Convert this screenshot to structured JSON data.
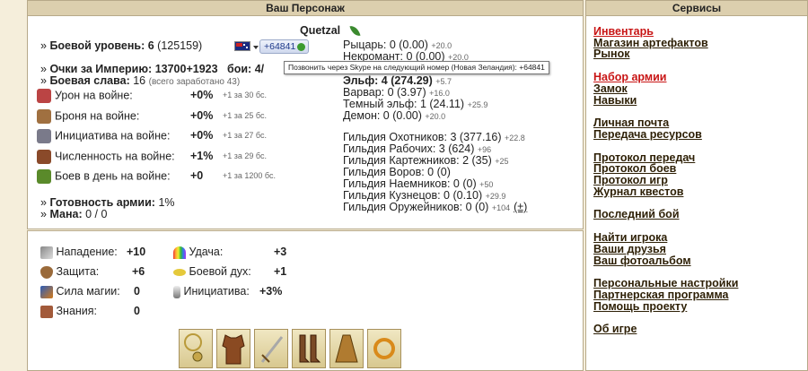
{
  "character": {
    "header": "Ваш Персонаж",
    "name": "Quetzal",
    "combat_level_label": "Боевой уровень:",
    "combat_level": "6",
    "combat_exp": "(125159)",
    "phone_number": "+64841",
    "phone_tooltip": "Позвонить через Skype на следующий номер (Новая Зеландия): +64841",
    "empire_points_label": "Очки за Империю:",
    "empire_points": "13700+1923",
    "battles_label": "бои:",
    "battles": "4/",
    "glory_label": "Боевая слава:",
    "glory": "16",
    "glory_total": "(всего заработано 43)",
    "war_rows": [
      {
        "label": "Урон на войне:",
        "value": "+0%",
        "note": "+1 за 30 бс.",
        "icon": "sword-damage-icon"
      },
      {
        "label": "Броня на войне:",
        "value": "+0%",
        "note": "+1 за 25 бс.",
        "icon": "armor-icon"
      },
      {
        "label": "Инициатива на войне:",
        "value": "+0%",
        "note": "+1 за 27 бс.",
        "icon": "initiative-icon"
      },
      {
        "label": "Численность на войне:",
        "value": "+1%",
        "note": "+1 за 29 бс.",
        "icon": "army-size-icon"
      },
      {
        "label": "Боев в день на войне:",
        "value": "+0",
        "note": "+1 за 1200 бс.",
        "icon": "battles-per-day-icon"
      }
    ],
    "readiness_label": "Готовность армии:",
    "readiness": "1%",
    "mana_label": "Мана:",
    "mana": "0 / 0",
    "factions": [
      {
        "text": "Рыцарь: 0 (0.00)",
        "note": "+20.0"
      },
      {
        "text": "Некромант: 0 (0.00)",
        "note": "+20.0"
      },
      {
        "text": "Эльф: 4 (274.29)",
        "note": "+5.7"
      },
      {
        "text": "Варвар: 0 (3.97)",
        "note": "+16.0"
      },
      {
        "text": "Темный эльф: 1 (24.11)",
        "note": "+25.9"
      },
      {
        "text": "Демон: 0 (0.00)",
        "note": "+20.0"
      }
    ],
    "guilds": [
      {
        "text": "Гильдия Охотников: 3 (377.16)",
        "note": "+22.8"
      },
      {
        "text": "Гильдия Рабочих: 3 (624)",
        "note": "+96"
      },
      {
        "text": "Гильдия Картежников: 2 (35)",
        "note": "+25"
      },
      {
        "text": "Гильдия Воров: 0 (0)",
        "note": ""
      },
      {
        "text": "Гильдия Наемников: 0 (0)",
        "note": "+50"
      },
      {
        "text": "Гильдия Кузнецов: 0 (0.10)",
        "note": "+29.9"
      },
      {
        "text": "Гильдия Оружейников: 0 (0)",
        "note": "+104"
      }
    ],
    "guild_plus": "(±)"
  },
  "stats": {
    "attack_label": "Нападение:",
    "attack": "+10",
    "defense_label": "Защита:",
    "defense": "+6",
    "magic_label": "Сила магии:",
    "magic": "0",
    "knowledge_label": "Знания:",
    "knowledge": "0",
    "luck_label": "Удача:",
    "luck": "+3",
    "morale_label": "Боевой дух:",
    "morale": "+1",
    "initiative_label": "Инициатива:",
    "initiative": "+3%"
  },
  "services": {
    "header": "Сервисы",
    "groups": [
      [
        {
          "label": "Инвентарь",
          "red": true
        },
        {
          "label": "Магазин артефактов"
        },
        {
          "label": "Рынок"
        }
      ],
      [
        {
          "label": "Набор армии",
          "red": true
        },
        {
          "label": "Замок"
        },
        {
          "label": "Навыки"
        }
      ],
      [
        {
          "label": "Личная почта"
        },
        {
          "label": "Передача ресурсов"
        }
      ],
      [
        {
          "label": "Протокол передач"
        },
        {
          "label": "Протокол боев"
        },
        {
          "label": "Протокол игр"
        },
        {
          "label": "Журнал квестов"
        }
      ],
      [
        {
          "label": "Последний бой"
        }
      ],
      [
        {
          "label": "Найти игрока"
        },
        {
          "label": "Ваши друзья"
        },
        {
          "label": "Ваш фотоальбом"
        }
      ],
      [
        {
          "label": "Персональные настройки"
        },
        {
          "label": "Партнерская программа"
        },
        {
          "label": "Помощь проекту"
        }
      ],
      [
        {
          "label": "Об игре"
        }
      ]
    ]
  },
  "artifacts": [
    "amulet-icon",
    "leather-armor-icon",
    "sword-icon",
    "boots-icon",
    "cloak-icon",
    "ring-icon"
  ]
}
